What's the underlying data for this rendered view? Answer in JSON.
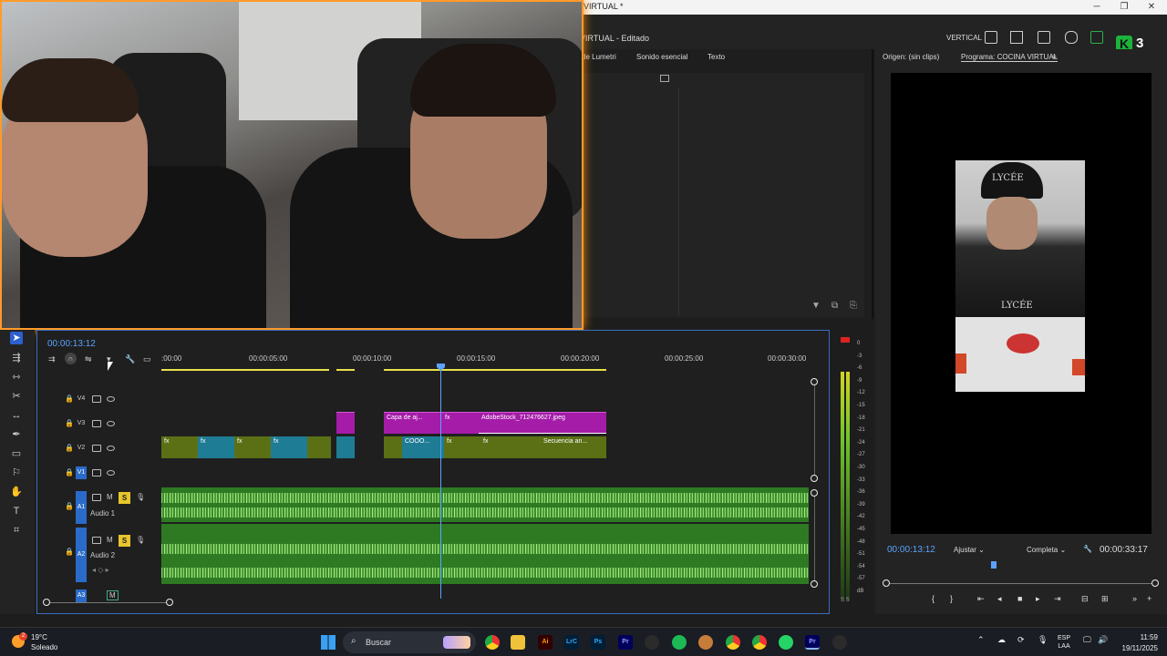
{
  "window": {
    "title": "VIRTUAL *",
    "controls": [
      "─",
      "❐",
      "✕"
    ]
  },
  "header": {
    "project": "VIRTUAL - Editado",
    "workspace": "VERTICAL",
    "badge_k": "K",
    "badge_num": "3"
  },
  "panel_tabs": [
    "de Lumetri",
    "Sonido esencial",
    "Texto"
  ],
  "program": {
    "source_tab": "Origen: (sin clips)",
    "program_tab": "Programa: COCINA VIRTUAL",
    "frame_labels": [
      "LYCÉE",
      "LYCÉE"
    ],
    "current_tc": "00:00:13:12",
    "fit": "Ajustar",
    "quality": "Completa",
    "duration": "00:00:33:17",
    "progress": 0.4
  },
  "timeline": {
    "timecode": "00:00:13:12",
    "ruler": [
      ":00:00",
      "00:00:05:00",
      "00:00:10:00",
      "00:00:15:00",
      "00:00:20:00",
      "00:00:25:00",
      "00:00:30:00"
    ],
    "tracks": {
      "v4": "V4",
      "v3": "V3",
      "v2": "V2",
      "v1": "V1",
      "a1": "A1",
      "a2": "A2",
      "a3": "A3",
      "audio1": "Audio 1",
      "audio2": "Audio 2",
      "m": "M",
      "s": "S"
    },
    "clips": {
      "capa": "Capa de aj...",
      "adobestock": "AdobeStock_712476627.jpeg",
      "cooo": "COOO...",
      "secuencia": "Secuencia an...",
      "fx": "fx"
    }
  },
  "meter": {
    "labels": [
      "0",
      "-3",
      "-6",
      "-9",
      "-12",
      "-15",
      "-18",
      "-21",
      "-24",
      "-27",
      "-30",
      "-33",
      "-36",
      "-39",
      "-42",
      "-45",
      "-48",
      "-51",
      "-54",
      "-57",
      "dB"
    ],
    "foot": "S S"
  },
  "taskbar": {
    "temp": "19°C",
    "weather": "Soleado",
    "weather_badge": "2",
    "search_placeholder": "Buscar",
    "apps": [
      "Ai",
      "LrC",
      "Ps",
      "Pr"
    ],
    "lang1": "ESP",
    "lang2": "LAA",
    "time": "11:59",
    "date": "19/11/2025"
  },
  "colors": {
    "accent_blue": "#5ba3ff",
    "clip_magenta": "#a41ca8",
    "clip_olive": "#5b7015",
    "clip_teal": "#1f7c95",
    "audio_green": "#2d7a22",
    "webcam_border": "#ff9a2a"
  }
}
